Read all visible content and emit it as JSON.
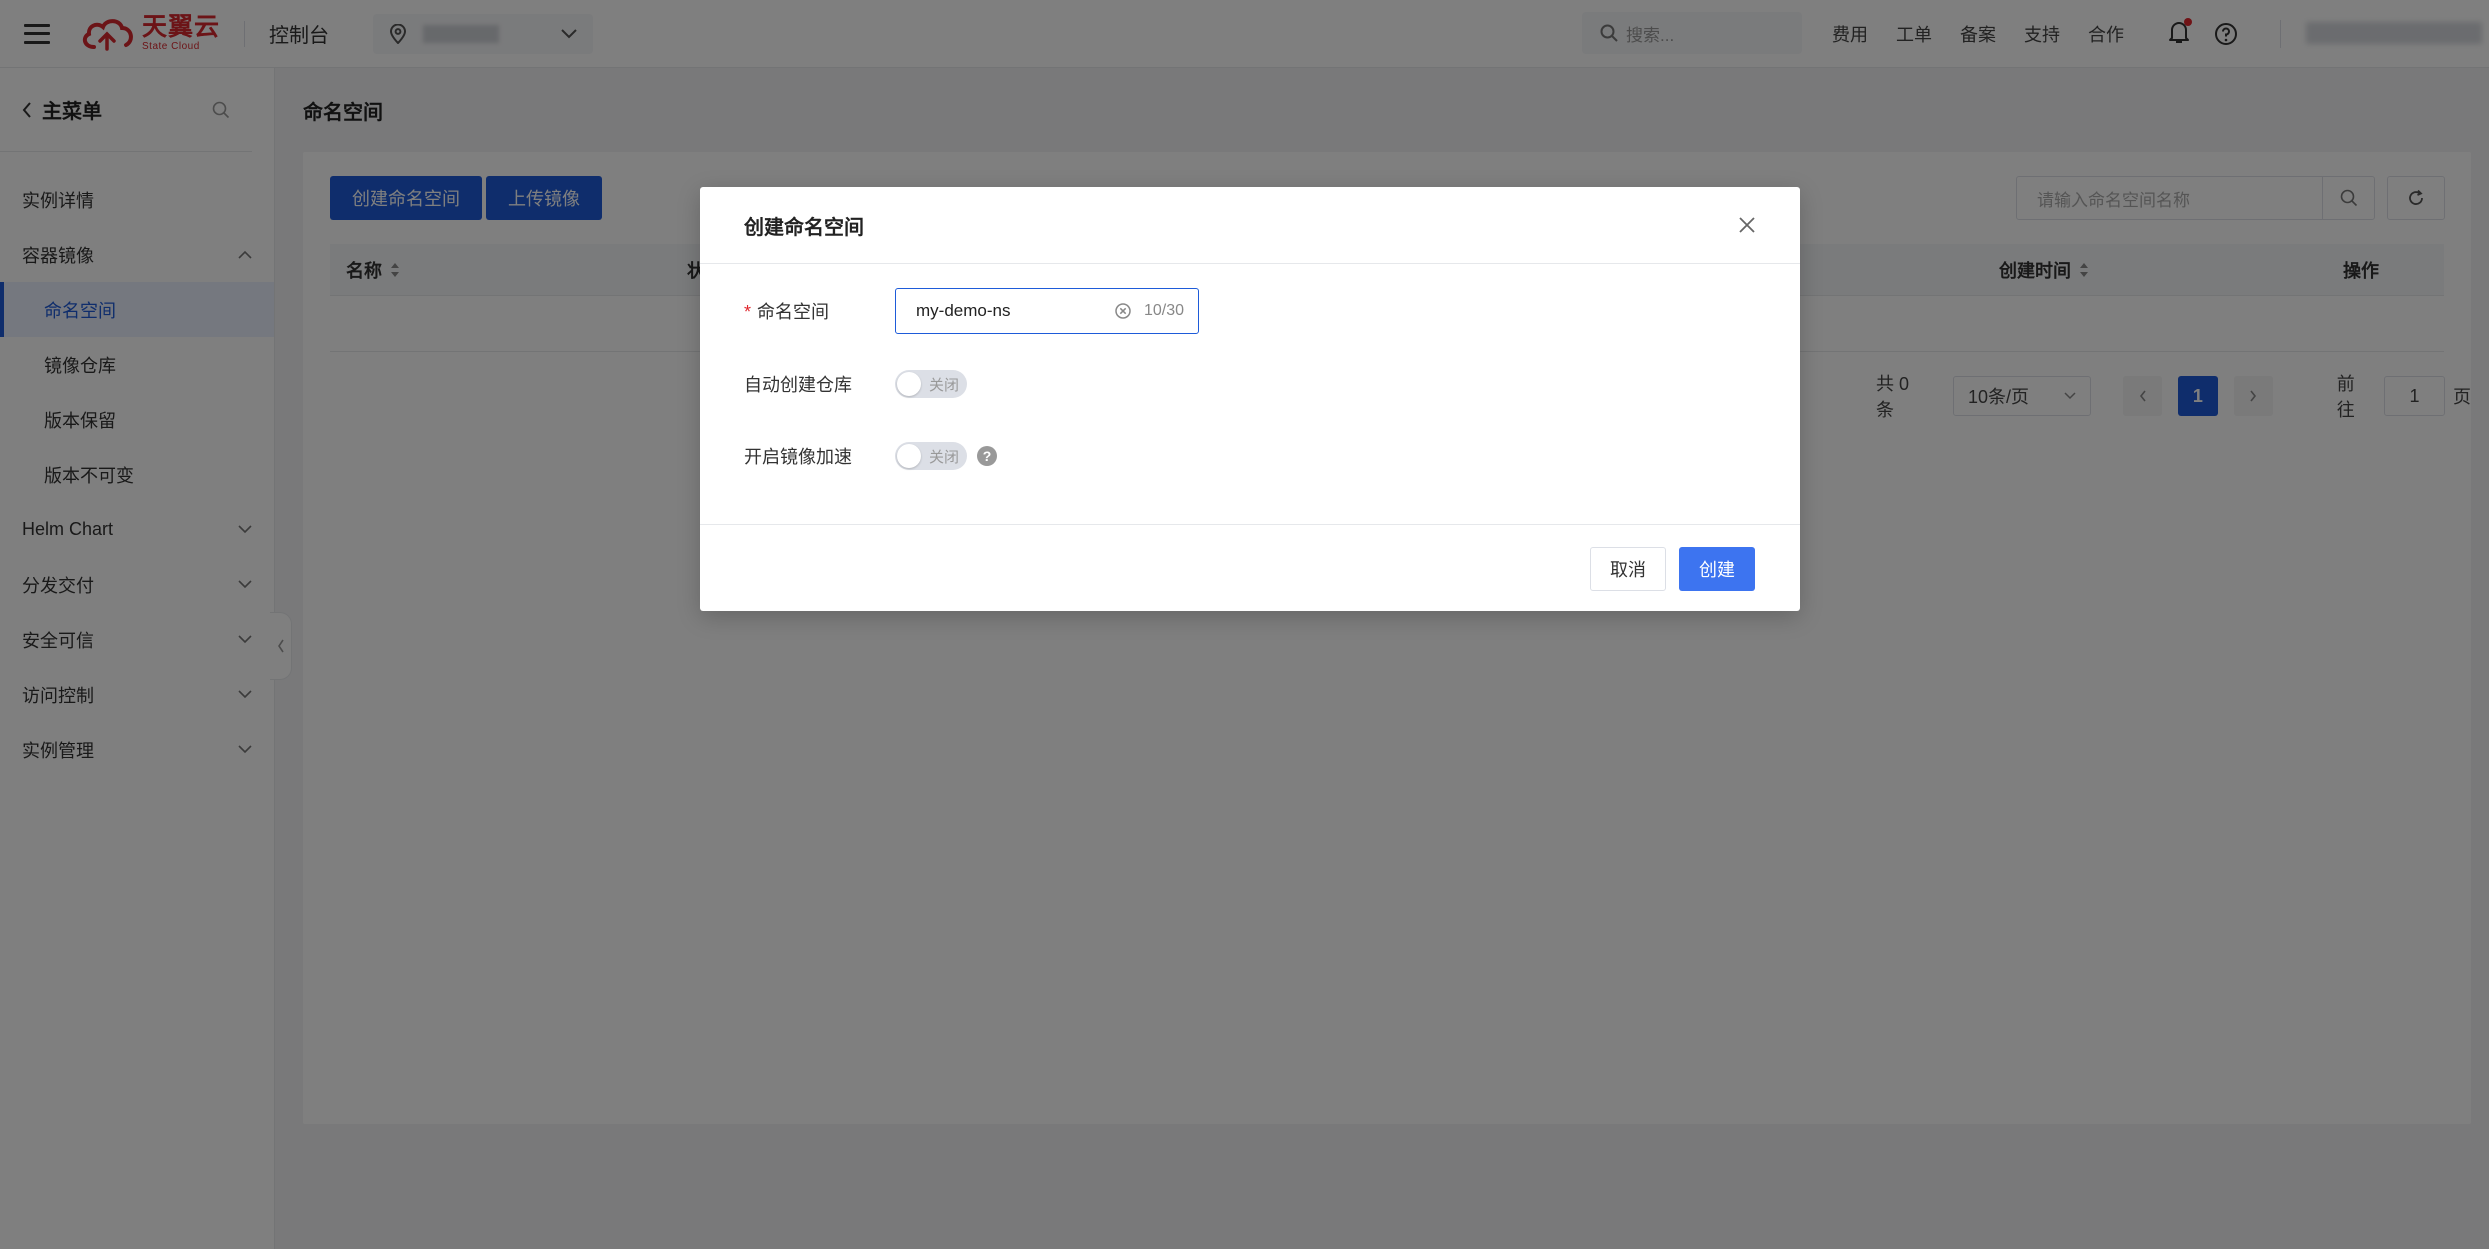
{
  "topbar": {
    "logo_cn": "天翼云",
    "logo_en": "State Cloud",
    "console_title": "控制台",
    "search_placeholder": "搜索...",
    "nav": [
      "费用",
      "工单",
      "备案",
      "支持",
      "合作"
    ]
  },
  "sidebar": {
    "title": "主菜单",
    "items": [
      {
        "label": "实例详情",
        "type": "item"
      },
      {
        "label": "容器镜像",
        "type": "group",
        "expanded": true
      },
      {
        "label": "命名空间",
        "type": "sub",
        "active": true
      },
      {
        "label": "镜像仓库",
        "type": "sub"
      },
      {
        "label": "版本保留",
        "type": "sub"
      },
      {
        "label": "版本不可变",
        "type": "sub"
      },
      {
        "label": "Helm Chart",
        "type": "group"
      },
      {
        "label": "分发交付",
        "type": "group"
      },
      {
        "label": "安全可信",
        "type": "group"
      },
      {
        "label": "访问控制",
        "type": "group"
      },
      {
        "label": "实例管理",
        "type": "group"
      }
    ]
  },
  "main": {
    "page_title": "命名空间",
    "create_button": "创建命名空间",
    "upload_button": "上传镜像",
    "search_placeholder": "请输入命名空间名称",
    "columns": {
      "name": "名称",
      "status_partial": "状",
      "created": "创建时间",
      "actions": "操作"
    },
    "pager": {
      "total": "共 0 条",
      "page_size": "10条/页",
      "current": "1",
      "goto_prefix": "前往",
      "goto_value": "1",
      "goto_suffix": "页"
    }
  },
  "modal": {
    "title": "创建命名空间",
    "namespace_label": "命名空间",
    "namespace_value": "my-demo-ns",
    "namespace_count": "10/30",
    "auto_repo_label": "自动创建仓库",
    "auto_repo_state": "关闭",
    "accel_label": "开启镜像加速",
    "accel_state": "关闭",
    "cancel": "取消",
    "create": "创建"
  },
  "colors": {
    "primary": "#1e5bd9",
    "brand_red": "#d9282f"
  }
}
